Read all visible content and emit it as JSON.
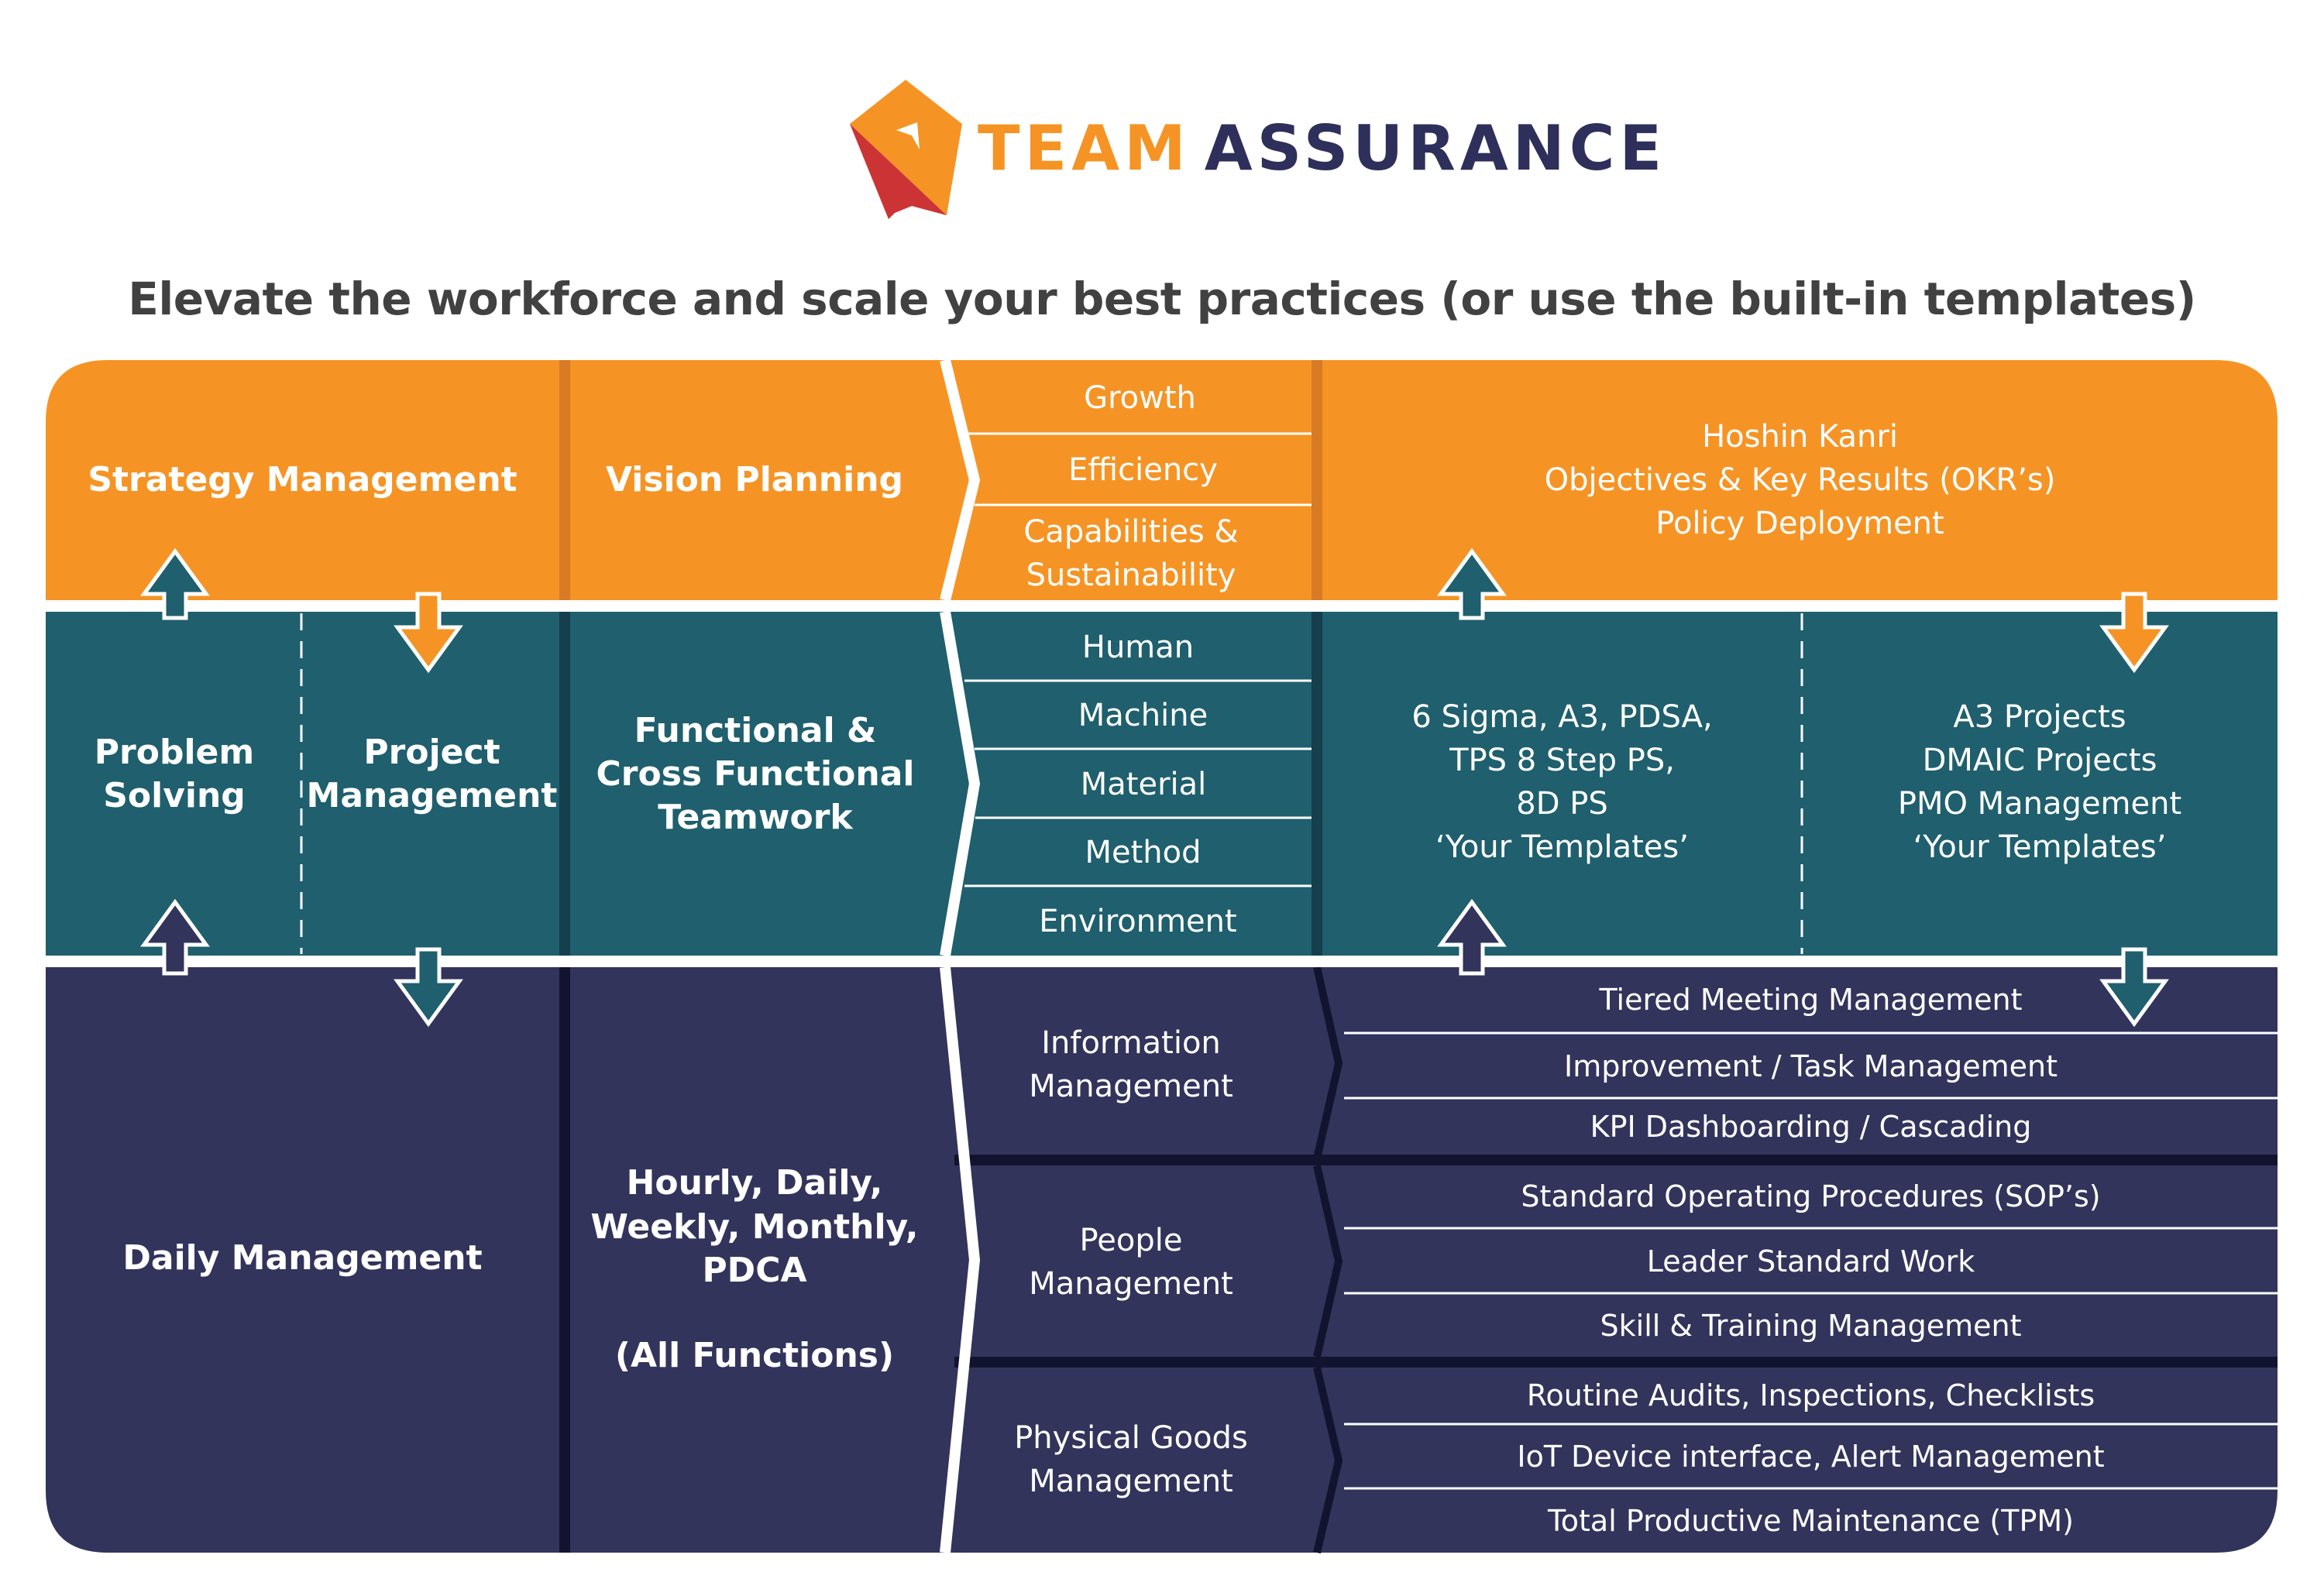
{
  "brand": {
    "name_part1": "TEAM",
    "name_part2": "ASSURANCE",
    "logo_icon": "kite-flag-logo",
    "colors": {
      "orange": "#f59425",
      "red": "#cc3335",
      "navy": "#2e2f5a"
    }
  },
  "headline": "Elevate the workforce and scale your best practices (or use the built-in templates)",
  "colors": {
    "strategy_band": "#f59425",
    "strategy_divider": "#d97a25",
    "problem_band": "#1f5f6e",
    "problem_divider": "#153f4d",
    "daily_band": "#32345c",
    "daily_divider": "#12142f",
    "headline_text": "#414141"
  },
  "tiers": [
    {
      "id": "strategy",
      "left_title": "Strategy Management",
      "cadence_title": "Vision Planning",
      "focus_items": [
        "Growth",
        "Efficiency",
        "Capabilities & Sustainability"
      ],
      "methods": [
        "Hoshin Kanri",
        "Objectives & Key Results (OKR’s)",
        "Policy Deployment"
      ]
    },
    {
      "id": "problem_project",
      "left_titles": [
        "Problem Solving",
        "Project Management"
      ],
      "cadence_title": "Functional & Cross Functional Teamwork",
      "focus_items": [
        "Human",
        "Machine",
        "Material",
        "Method",
        "Environment"
      ],
      "problem_methods": [
        "6 Sigma, A3, PDSA,",
        "TPS 8 Step PS,",
        "8D PS",
        "‘Your Templates’"
      ],
      "project_methods": [
        "A3 Projects",
        "DMAIC Projects",
        "PMO Management",
        "‘Your Templates’"
      ]
    },
    {
      "id": "daily",
      "left_title": "Daily Management",
      "cadence_title": [
        "Hourly, Daily,",
        "Weekly, Monthly,",
        "PDCA",
        "",
        "(All Functions)"
      ],
      "groups": [
        {
          "name": "Information Management",
          "items": [
            "Tiered Meeting Management",
            "Improvement / Task Management",
            "KPI Dashboarding / Cascading"
          ]
        },
        {
          "name": "People Management",
          "items": [
            "Standard Operating Procedures (SOP’s)",
            "Leader Standard Work",
            "Skill & Training Management"
          ]
        },
        {
          "name": "Physical Goods Management",
          "items": [
            "Routine Audits, Inspections, Checklists",
            "IoT Device interface, Alert Management",
            "Total Productive Maintenance (TPM)"
          ]
        }
      ]
    }
  ],
  "flow_arrows": [
    {
      "name": "problem-to-strategy-arrow",
      "direction": "up",
      "color": "#1f5f6e"
    },
    {
      "name": "strategy-to-project-arrow",
      "direction": "down",
      "color": "#f59425"
    },
    {
      "name": "daily-to-problem-arrow",
      "direction": "up",
      "color": "#32345c"
    },
    {
      "name": "project-to-daily-arrow",
      "direction": "down",
      "color": "#1f5f6e"
    },
    {
      "name": "problem-methods-to-strategy-arrow",
      "direction": "up",
      "color": "#1f5f6e"
    },
    {
      "name": "strategy-to-project-methods-arrow",
      "direction": "down",
      "color": "#f59425"
    },
    {
      "name": "daily-to-problem-methods-arrow",
      "direction": "up",
      "color": "#32345c"
    },
    {
      "name": "project-methods-to-daily-arrow",
      "direction": "down",
      "color": "#1f5f6e"
    }
  ]
}
